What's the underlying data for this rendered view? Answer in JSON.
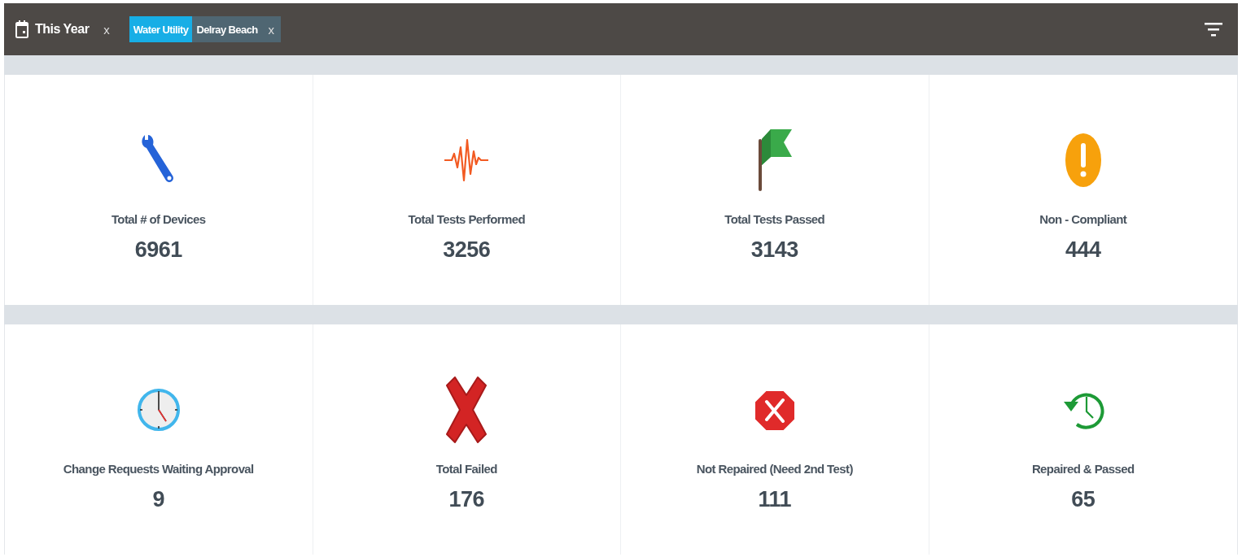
{
  "filter_bar": {
    "date_filter": {
      "label": "This Year",
      "remove": "x"
    },
    "tag_filter": {
      "tags": [
        "Water Utility",
        "Delray Beach"
      ],
      "remove": "x"
    }
  },
  "rows": [
    {
      "cards": [
        {
          "kind": "wrench",
          "label": "Total # of Devices",
          "value": "6961"
        },
        {
          "kind": "pulse",
          "label": "Total Tests Performed",
          "value": "3256"
        },
        {
          "kind": "flag",
          "label": "Total Tests Passed",
          "value": "3143"
        },
        {
          "kind": "alert",
          "label": "Non - Compliant",
          "value": "444"
        }
      ]
    },
    {
      "cards": [
        {
          "kind": "clock",
          "label": "Change Requests Waiting Approval",
          "value": "9"
        },
        {
          "kind": "cross",
          "label": "Total Failed",
          "value": "176"
        },
        {
          "kind": "stop",
          "label": "Not Repaired (Need 2nd Test)",
          "value": "111"
        },
        {
          "kind": "history",
          "label": "Repaired & Passed",
          "value": "65"
        }
      ]
    }
  ]
}
